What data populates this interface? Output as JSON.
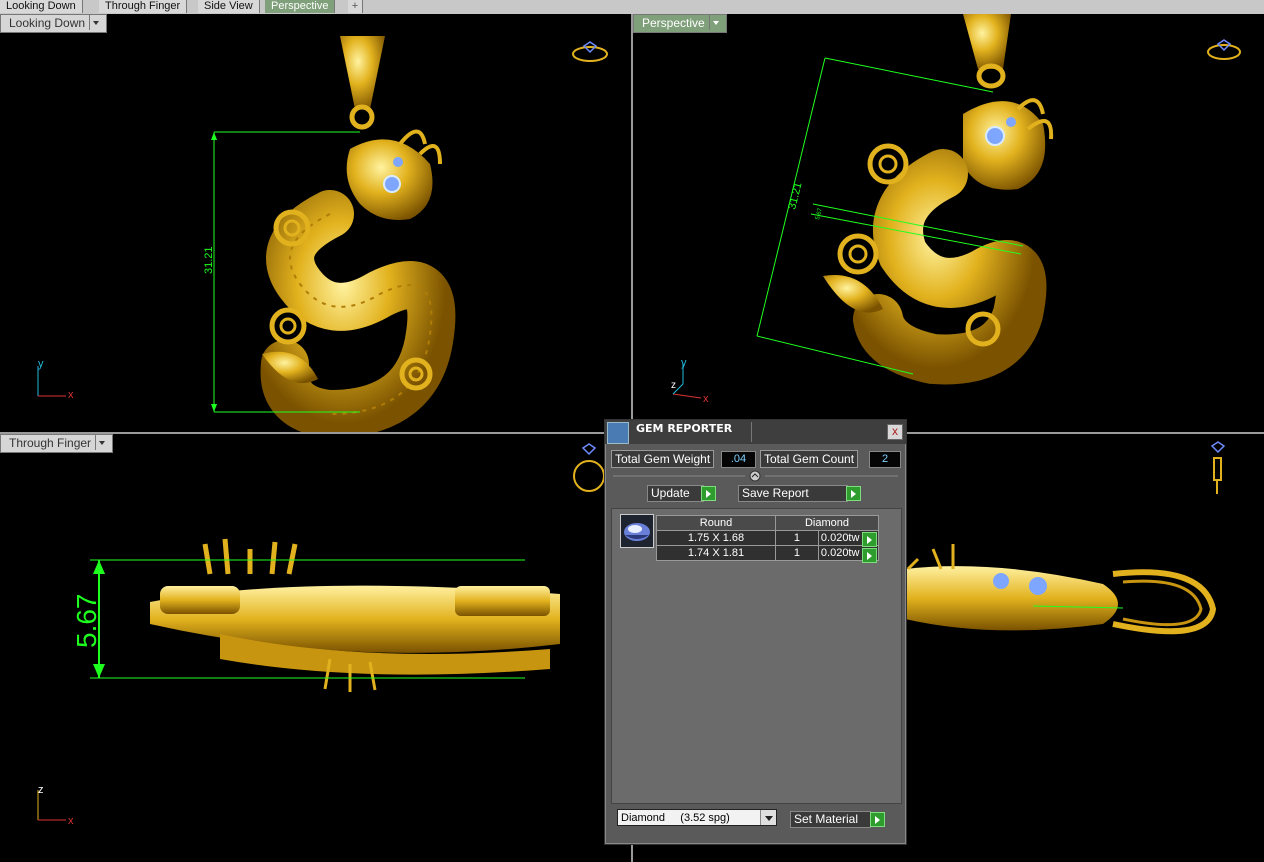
{
  "tabs": {
    "items": [
      "Looking Down",
      "Through Finger",
      "Side View",
      "Perspective"
    ],
    "active": "Perspective",
    "add_label": "+"
  },
  "viewports": {
    "top_left": {
      "label": "Looking Down",
      "dimension": "31.21",
      "axis_y": "y",
      "axis_x": "x"
    },
    "top_right": {
      "label": "Perspective",
      "dimension": "31.21",
      "dimension_small": "5.67",
      "axis_y": "y",
      "axis_z": "z",
      "axis_x": "x"
    },
    "bottom_left": {
      "label": "Through Finger",
      "dimension": "5.67",
      "axis_z": "z",
      "axis_x": "x"
    }
  },
  "gem_reporter": {
    "title": "GEM REPORTER",
    "close_label": "x",
    "total_weight_label": "Total Gem Weight",
    "total_weight_value": ".04",
    "total_count_label": "Total Gem Count",
    "total_count_value": "2",
    "update_label": "Update",
    "save_report_label": "Save Report",
    "table": {
      "headers": [
        "Round",
        "Diamond"
      ],
      "rows": [
        {
          "size": "1.75 X 1.68",
          "count": "1",
          "weight": "0.020tw"
        },
        {
          "size": "1.74 X 1.81",
          "count": "1",
          "weight": "0.020tw"
        }
      ]
    },
    "material_select": "Diamond     (3.52 spg)",
    "set_material_label": "Set Material"
  },
  "colors": {
    "gold": "#d9a818",
    "dimension_green": "#1fff1f",
    "viewport_bg": "#000000",
    "perspective_tab": "#7fa07a"
  },
  "icons": [
    "ring-gem-icon",
    "ring-side-icon",
    "pendant-gem-icon",
    "gem-thumbnail-icon"
  ]
}
